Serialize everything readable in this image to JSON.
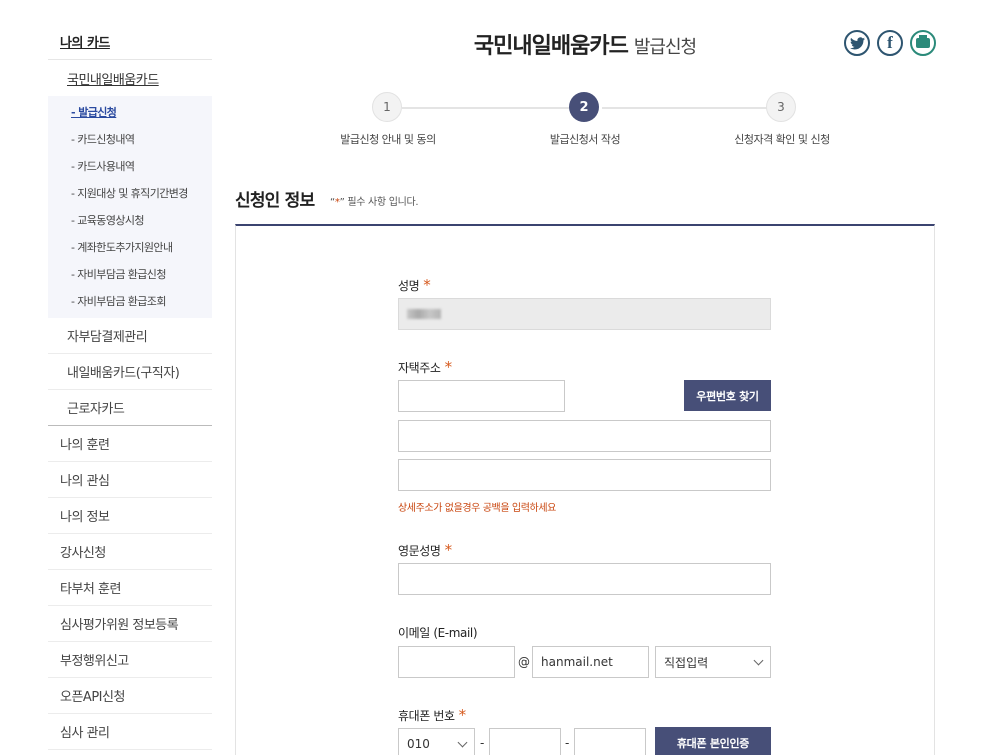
{
  "sidebar": {
    "title": "나의 카드",
    "sub_title": "국민내일배움카드",
    "sub_items": [
      "- 발급신청",
      "- 카드신청내역",
      "- 카드사용내역",
      "- 지원대상 및 휴직기간변경",
      "- 교육동영상시청",
      "- 계좌한도추가지원안내",
      "- 자비부담금 환급신청",
      "- 자비부담금 환급조회"
    ],
    "level2": [
      "자부담결제관리",
      "내일배움카드(구직자)",
      "근로자카드"
    ],
    "level1": [
      "나의 훈련",
      "나의 관심",
      "나의 정보",
      "강사신청",
      "타부처 훈련",
      "심사평가위원 정보등록",
      "부정행위신고",
      "오픈API신청",
      "심사 관리"
    ]
  },
  "header": {
    "title": "국민내일배움카드",
    "subtitle": "발급신청",
    "share_icons": [
      "twitter-icon",
      "facebook-icon",
      "print-icon"
    ]
  },
  "stepper": {
    "active_step": 2,
    "steps": [
      {
        "num": "1",
        "label": "발급신청 안내 및 동의"
      },
      {
        "num": "2",
        "label": "발급신청서 작성"
      },
      {
        "num": "3",
        "label": "신청자격 확인 및 신청"
      }
    ]
  },
  "section": {
    "title": "신청인 정보",
    "note_prefix": "“",
    "note_star": "*",
    "note_text": "” 필수 사항 입니다."
  },
  "form": {
    "name_label": "성명",
    "address_label": "자택주소",
    "zip_button": "우편번호 찾기",
    "address_hint": "상세주소가 없을경우 공백을 입력하세요",
    "eng_name_label": "영문성명",
    "email_label": "이메일 (E-mail)",
    "email_at": "@",
    "email_domain": "hanmail.net",
    "email_select": "직접입력",
    "phone_label": "휴대폰 번호",
    "phone_prefix": "010",
    "phone_dash": "-",
    "phone_verify_button": "휴대폰 본인인증",
    "required_mark": "*"
  },
  "colors": {
    "accent": "#474f78",
    "required": "#d65a1e",
    "hint": "#c9460f"
  }
}
